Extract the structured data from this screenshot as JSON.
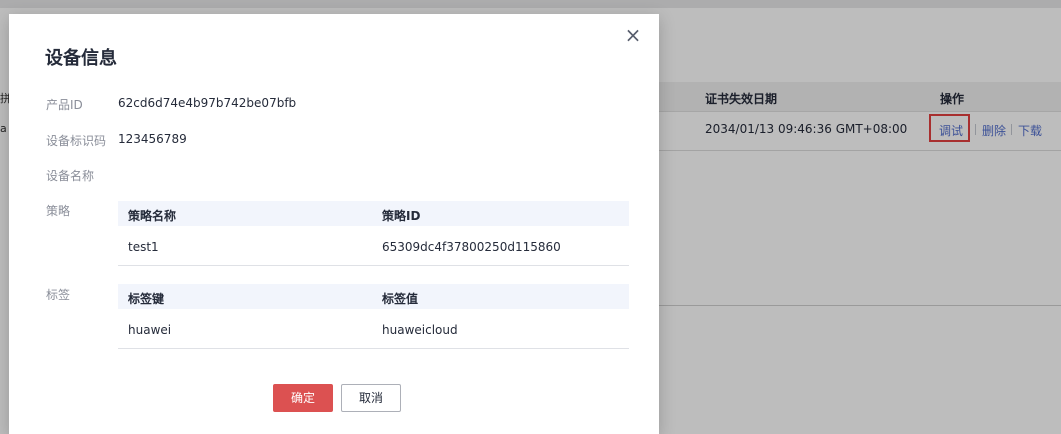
{
  "background": {
    "table_headers": [
      "证书失效日期",
      "操作"
    ],
    "row": {
      "expiry": "2034/01/13 09:46:36 GMT+08:00",
      "actions": [
        "调试",
        "删除",
        "下载"
      ]
    },
    "left_glyphs": [
      "拼",
      "a"
    ],
    "highlight_color": "#e34040"
  },
  "dialog": {
    "title": "设备信息",
    "close_icon": "close-icon",
    "fields": [
      {
        "label": "产品ID",
        "value": "62cd6d74e4b97b742be07bfb"
      },
      {
        "label": "设备标识码",
        "value": "123456789"
      },
      {
        "label": "设备名称",
        "value": ""
      },
      {
        "label": "策略",
        "value": ""
      },
      {
        "label": "标签",
        "value": ""
      }
    ],
    "policy_table": {
      "headers": [
        "策略名称",
        "策略ID"
      ],
      "rows": [
        [
          "test1",
          "65309dc4f37800250d115860"
        ]
      ]
    },
    "tag_table": {
      "headers": [
        "标签键",
        "标签值"
      ],
      "rows": [
        [
          "huawei",
          "huaweicloud"
        ]
      ]
    },
    "buttons": {
      "ok": "确定",
      "cancel": "取消"
    },
    "ok_color": "#dc5151"
  }
}
